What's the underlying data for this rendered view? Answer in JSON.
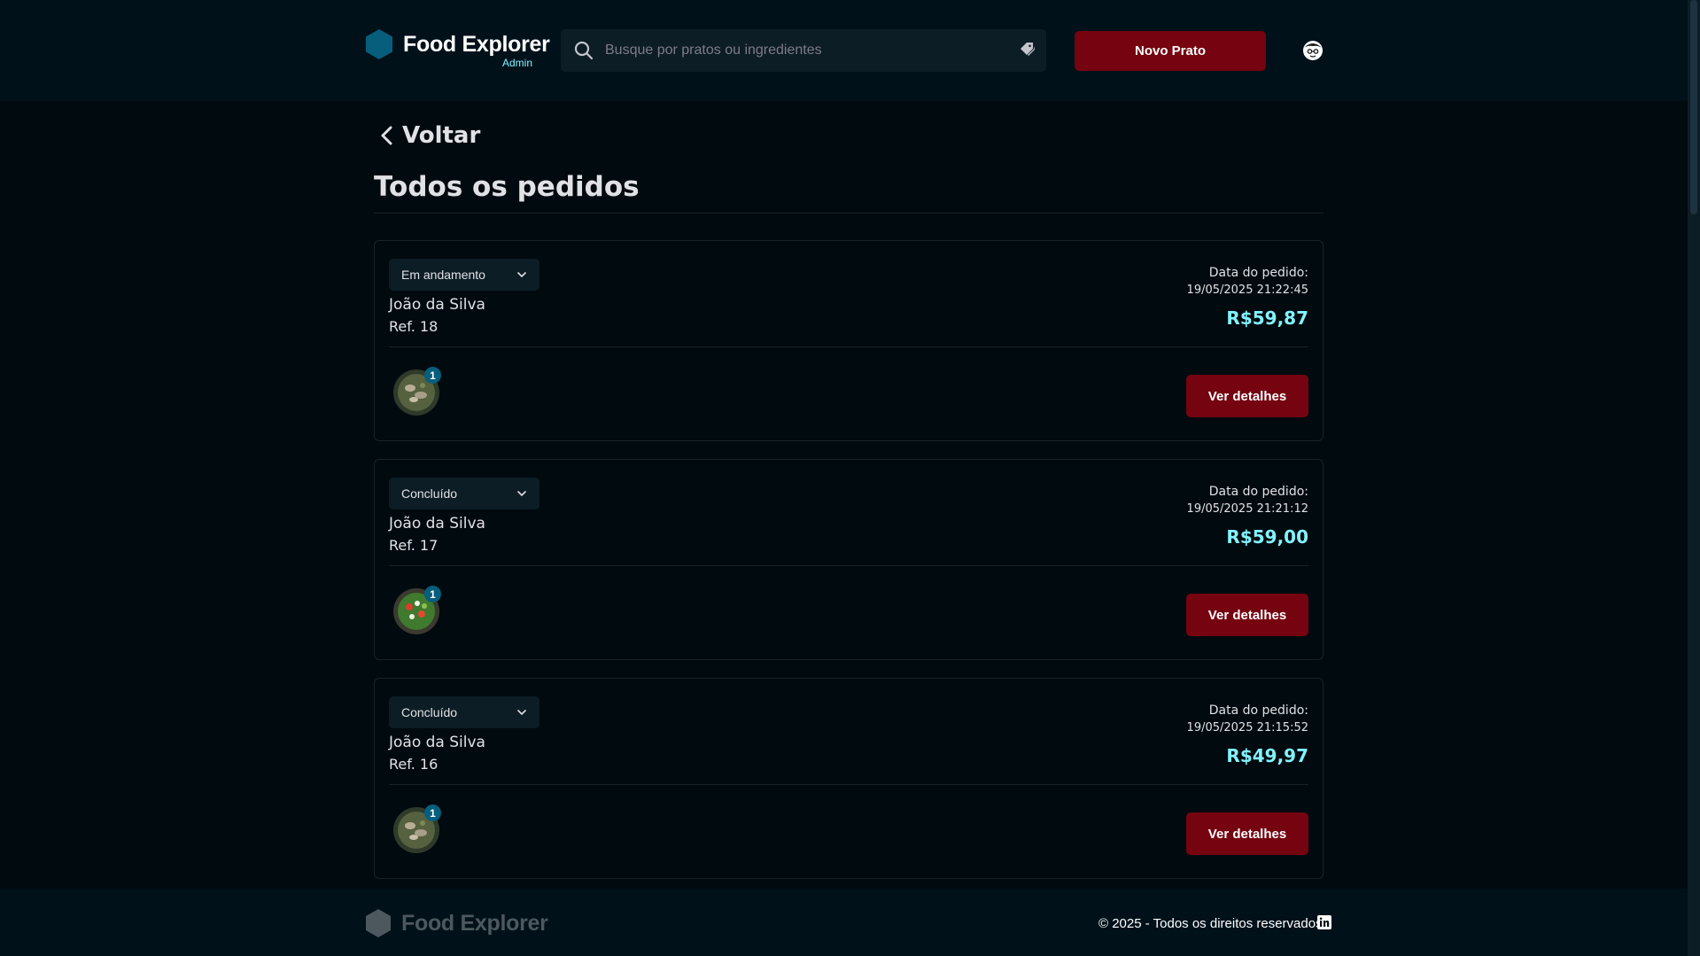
{
  "header": {
    "brand_title": "Food Explorer",
    "brand_sub": "Admin",
    "search_placeholder": "Busque por pratos ou ingredientes",
    "new_dish_label": "Novo Prato"
  },
  "main": {
    "back_label": "Voltar",
    "title": "Todos os pedidos",
    "orders": [
      {
        "status": "Em andamento",
        "customer": "João da Silva",
        "ref": "Ref. 18",
        "date_label": "Data do pedido:",
        "date": "19/05/2025 21:22:45",
        "total": "R$59,87",
        "item_count": "1",
        "details_label": "Ver detalhes"
      },
      {
        "status": "Concluído",
        "customer": "João da Silva",
        "ref": "Ref. 17",
        "date_label": "Data do pedido:",
        "date": "19/05/2025 21:21:12",
        "total": "R$59,00",
        "item_count": "1",
        "details_label": "Ver detalhes"
      },
      {
        "status": "Concluído",
        "customer": "João da Silva",
        "ref": "Ref. 16",
        "date_label": "Data do pedido:",
        "date": "19/05/2025 21:15:52",
        "total": "R$49,97",
        "item_count": "1",
        "details_label": "Ver detalhes"
      }
    ]
  },
  "footer": {
    "brand_title": "Food Explorer",
    "copyright": "© 2025 - Todos os direitos reservados."
  },
  "colors": {
    "background": "#000a0f",
    "header_bg": "#00111a",
    "accent_button": "#750310",
    "price": "#82f3ff",
    "badge": "#065e7c"
  },
  "icons": [
    "logo-hexagon-icon",
    "search-icon",
    "tag-icon",
    "avatar-icon",
    "chevron-left-icon",
    "chevron-down-icon",
    "dish-thumbnail",
    "linkedin-icon"
  ]
}
